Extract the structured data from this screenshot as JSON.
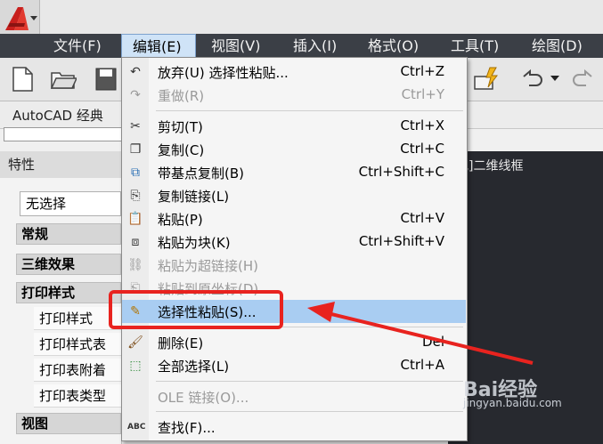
{
  "menubar": {
    "items": [
      {
        "label": "文件(F)"
      },
      {
        "label": "编辑(E)"
      },
      {
        "label": "视图(V)"
      },
      {
        "label": "插入(I)"
      },
      {
        "label": "格式(O)"
      },
      {
        "label": "工具(T)"
      },
      {
        "label": "绘图(D)"
      }
    ]
  },
  "workspace": {
    "label": "AutoCAD 经典"
  },
  "properties": {
    "title": "特性",
    "selection": "无选择",
    "sections": [
      {
        "label": "常规"
      },
      {
        "label": "三维效果"
      },
      {
        "label": "打印样式"
      },
      {
        "label": "视图"
      }
    ],
    "rows": [
      {
        "label": "打印样式"
      },
      {
        "label": "打印样式表"
      },
      {
        "label": "打印表附着"
      },
      {
        "label": "打印表类型"
      }
    ]
  },
  "viewport": {
    "label": "视]二维线框"
  },
  "edit_menu": {
    "items": [
      {
        "label": "放弃(U) 选择性粘贴...",
        "shortcut": "Ctrl+Z",
        "icon": "undo-icon",
        "enabled": true
      },
      {
        "label": "重做(R)",
        "shortcut": "Ctrl+Y",
        "icon": "redo-icon",
        "enabled": false
      },
      {
        "label": "剪切(T)",
        "shortcut": "Ctrl+X",
        "icon": "scissors-icon",
        "enabled": true
      },
      {
        "label": "复制(C)",
        "shortcut": "Ctrl+C",
        "icon": "copy-icon",
        "enabled": true
      },
      {
        "label": "带基点复制(B)",
        "shortcut": "Ctrl+Shift+C",
        "icon": "copy-base-icon",
        "enabled": true
      },
      {
        "label": "复制链接(L)",
        "shortcut": "",
        "icon": "copy-link-icon",
        "enabled": true
      },
      {
        "label": "粘贴(P)",
        "shortcut": "Ctrl+V",
        "icon": "paste-icon",
        "enabled": true
      },
      {
        "label": "粘贴为块(K)",
        "shortcut": "Ctrl+Shift+V",
        "icon": "paste-block-icon",
        "enabled": true
      },
      {
        "label": "粘贴为超链接(H)",
        "shortcut": "",
        "icon": "paste-hyperlink-icon",
        "enabled": false
      },
      {
        "label": "粘贴到原坐标(D)",
        "shortcut": "",
        "icon": "paste-original-icon",
        "enabled": false
      },
      {
        "label": "选择性粘贴(S)...",
        "shortcut": "",
        "icon": "paste-special-icon",
        "enabled": true,
        "highlighted": true
      },
      {
        "label": "删除(E)",
        "shortcut": "Del",
        "icon": "erase-icon",
        "enabled": true
      },
      {
        "label": "全部选择(L)",
        "shortcut": "Ctrl+A",
        "icon": "select-all-icon",
        "enabled": true
      },
      {
        "label": "OLE 链接(O)...",
        "shortcut": "",
        "icon": "",
        "enabled": false
      },
      {
        "label": "查找(F)...",
        "shortcut": "",
        "icon": "find-icon",
        "enabled": true
      }
    ]
  },
  "watermark": {
    "brand": "Bai经验",
    "url": "jingyan.baidu.com"
  },
  "colors": {
    "menubar": "#3b3f46",
    "highlight": "#a9cdf2",
    "annotation": "#e8231f",
    "viewport": "#27292f"
  }
}
